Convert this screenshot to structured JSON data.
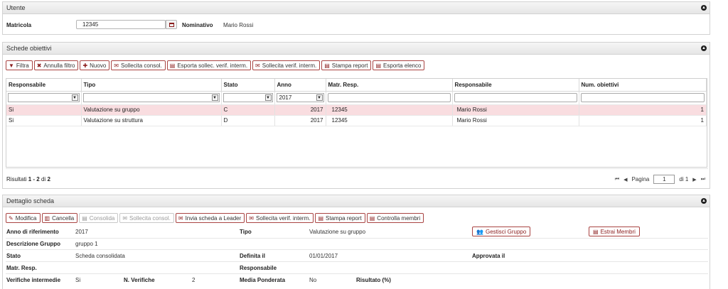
{
  "utente": {
    "title": "Utente",
    "matricola_label": "Matricola",
    "matricola_value": "12345",
    "nominativo_label": "Nominativo",
    "nominativo_value": "Mario Rossi"
  },
  "schede": {
    "title": "Schede obiettivi",
    "toolbar": {
      "filtra": "Filtra",
      "annulla_filtro": "Annulla filtro",
      "nuovo": "Nuovo",
      "sollecita_consol": "Sollecita consol.",
      "esporta_sollec": "Esporta sollec. verif. interm.",
      "sollecita_verif": "Sollecita verif. interm.",
      "stampa_report": "Stampa report",
      "esporta_elenco": "Esporta elenco"
    },
    "columns": [
      "Responsabile",
      "Tipo",
      "Stato",
      "Anno",
      "Matr. Resp.",
      "Responsabile",
      "Num. obiettivi"
    ],
    "filter_anno": "2017",
    "rows": [
      [
        "Si",
        "Valutazione su gruppo",
        "C",
        "2017",
        "12345",
        "Mario Rossi",
        "1"
      ],
      [
        "Si",
        "Valutazione su struttura",
        "D",
        "2017",
        "12345",
        "Mario Rossi",
        "1"
      ]
    ],
    "results": {
      "prefix": "Risultati",
      "from": "1",
      "dash": "-",
      "to": "2",
      "of_label": "di",
      "total": "2"
    },
    "pager": {
      "page_label": "Pagina",
      "page_value": "1",
      "of_label": "di 1"
    }
  },
  "dettaglio": {
    "title": "Dettaglio scheda",
    "toolbar": {
      "modifica": "Modifica",
      "cancella": "Cancella",
      "consolida": "Consolida",
      "sollecita_consol": "Sollecita consol.",
      "invia_leader": "Invia scheda a Leader",
      "sollecita_verif": "Sollecita verif. interm.",
      "stampa_report": "Stampa report",
      "controlla_membri": "Controlla membri"
    },
    "fields": {
      "anno_label": "Anno di riferimento",
      "anno_value": "2017",
      "tipo_label": "Tipo",
      "tipo_value": "Valutazione su gruppo",
      "gestisci_gruppo": "Gestisci Gruppo",
      "estrai_membri": "Estrai Membri",
      "descrizione_label": "Descrizione Gruppo",
      "descrizione_value": "gruppo 1",
      "stato_label": "Stato",
      "stato_value": "Scheda consolidata",
      "definita_label": "Definita il",
      "definita_value": "01/01/2017",
      "approvata_label": "Approvata il",
      "matr_resp_label": "Matr. Resp.",
      "responsabile_label": "Responsabile",
      "verifiche_label": "Verifiche intermedie",
      "verifiche_value": "Si",
      "n_verifiche_label": "N. Verifiche",
      "n_verifiche_value": "2",
      "media_label": "Media Ponderata",
      "media_value": "No",
      "risultato_label": "Risultato (%)"
    }
  },
  "colors": {
    "accent": "#8b1d1d",
    "button_border": "#a94442",
    "selected_row": "#f9dde0"
  }
}
